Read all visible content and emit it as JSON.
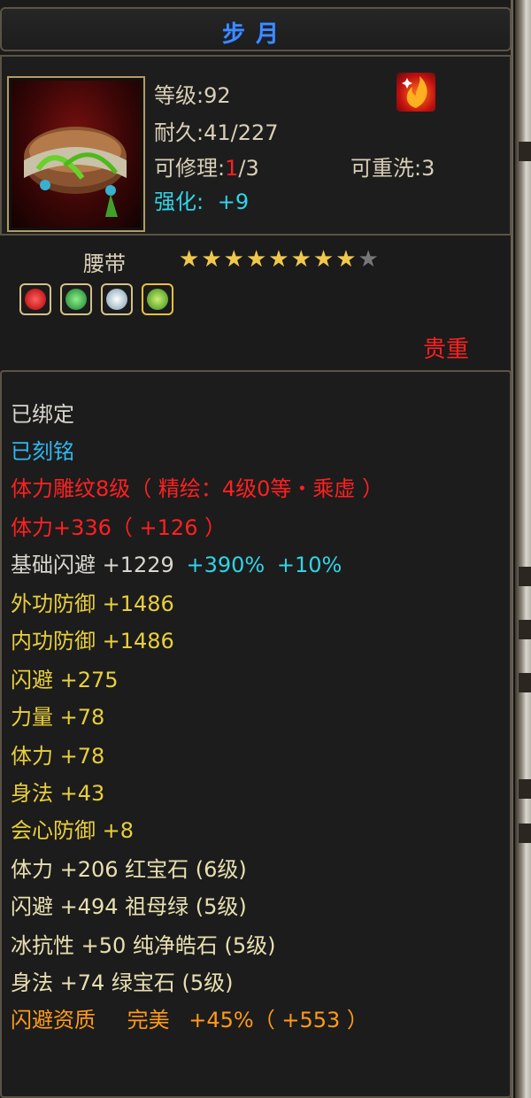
{
  "title": "步月",
  "item": {
    "level": "等级:92",
    "durability": "耐久:41/227",
    "repair_label": "可修理:",
    "repair_used": "1",
    "repair_total": "/3",
    "reroll": "可重洗:3",
    "enhance_label": "强化:",
    "enhance_value": "+9",
    "type": "腰带",
    "rarity": "贵重",
    "stars_filled": 8,
    "stars_total": 9,
    "gem_icons": [
      "ruby-icon",
      "emerald-icon",
      "diamond-icon",
      "green-gem-icon"
    ],
    "grade_icon": "flame-icon"
  },
  "attributes": {
    "bound": "已绑定",
    "engraved": "已刻铭",
    "carving": "体力雕纹8级（ 精绘：4级0等・乘虚 ）",
    "stamina_main": "体力+336（ +126 ）",
    "dodge_base_label": "基础闪避 +1229",
    "dodge_base_bonus1": "+390%",
    "dodge_base_bonus2": "+10%",
    "outer_def": "外功防御 +1486",
    "inner_def": "内功防御 +1486",
    "dodge": "闪避 +275",
    "strength": "力量 +78",
    "stamina": "体力 +78",
    "agility": "身法 +43",
    "crit_def": "会心防御 +8",
    "gem1": "体力 +206 红宝石 (6级)",
    "gem2": "闪避 +494 祖母绿 (5级)",
    "gem3": "冰抗性 +50 纯净皓石 (5级)",
    "gem4": "身法 +74 绿宝石 (5级)",
    "quality_label": "闪避资质",
    "quality_grade": "完美",
    "quality_value": "+45%（ +553 ）"
  },
  "colors": {
    "blue": "#3f8cff",
    "red": "#ff2020",
    "cyan": "#2fd4e8",
    "gold": "#e8cf3c",
    "white": "#d9d6cf",
    "orange": "#ff9a1a"
  }
}
